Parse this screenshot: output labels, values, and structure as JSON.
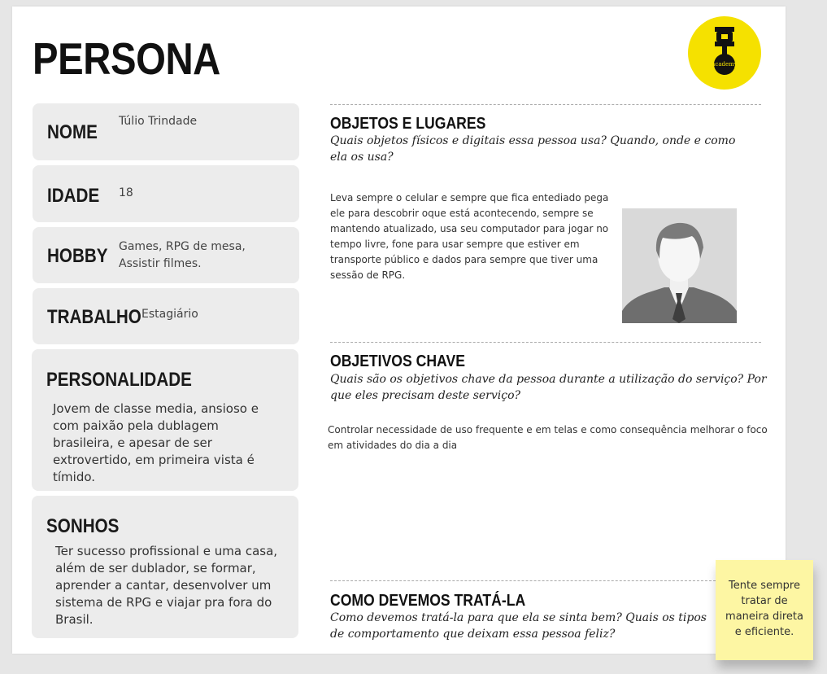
{
  "title": "PERSONA",
  "logo": {
    "icon": "dt-academy-logo",
    "text": "academy",
    "color": "#f5e100"
  },
  "profile": {
    "name": {
      "label": "NOME",
      "value": "Túlio Trindade"
    },
    "age": {
      "label": "IDADE",
      "value": "18"
    },
    "hobby": {
      "label": "HOBBY",
      "value": "Games, RPG de mesa, Assistir filmes."
    },
    "job": {
      "label": "TRABALHO",
      "value": "Estagiário"
    },
    "personality": {
      "label": "PERSONALIDADE",
      "value": "Jovem de classe media, ansioso e com paixão pela dublagem brasileira, e apesar de ser extrovertido, em primeira vista é tímido."
    },
    "dreams": {
      "label": "SONHOS",
      "value": "Ter sucesso profissional e uma casa, além de ser dublador, se formar, aprender a cantar, desenvolver um sistema de RPG e viajar pra fora do Brasil."
    }
  },
  "sections": {
    "objects": {
      "title": "OBJETOS E LUGARES",
      "question": "Quais objetos físicos e digitais essa pessoa usa? Quando, onde e como ela os usa?",
      "answer": "Leva sempre o celular e sempre que fica entediado pega ele para descobrir oque está acontecendo, sempre se mantendo atualizado, usa seu computador para jogar no tempo livre, fone para usar sempre que estiver em transporte público e dados para sempre que tiver uma sessão de RPG."
    },
    "goals": {
      "title": "OBJETIVOS CHAVE",
      "question": "Quais são os objetivos chave da pessoa durante a utilização do serviço? Por que eles precisam deste serviço?",
      "answer": "Controlar necessidade de uso frequente e em telas e como consequência melhorar o foco em atividades do dia a dia"
    },
    "treatment": {
      "title": "COMO DEVEMOS TRATÁ-LA",
      "question": "Como devemos tratá-la para que ela se sinta bem? Quais os tipos de comportamento que deixam essa pessoa feliz?"
    }
  },
  "sticky_note": {
    "text": "Tente sempre tratar de maneira direta e eficiente.",
    "color": "#fdf6a3"
  },
  "avatar": {
    "icon": "person-silhouette-icon"
  }
}
